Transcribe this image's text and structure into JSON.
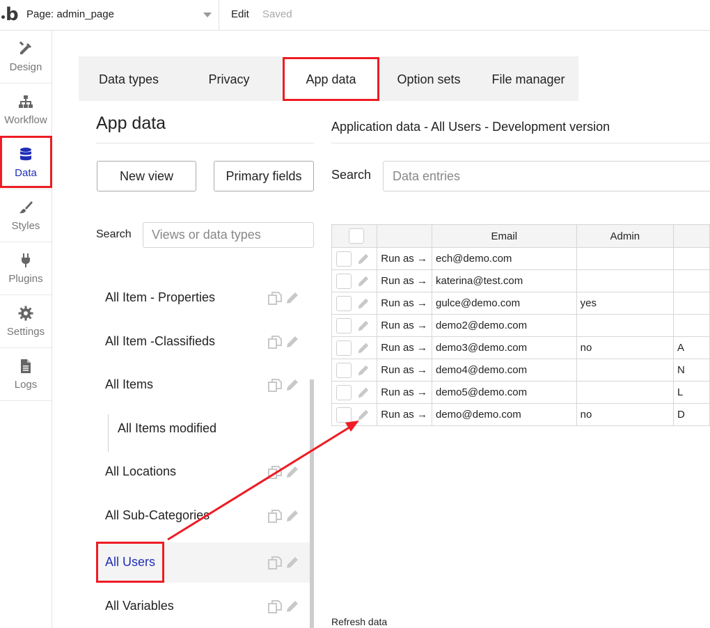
{
  "topbar": {
    "page_label": "Page: admin_page",
    "edit_label": "Edit",
    "saved_label": "Saved"
  },
  "nav": {
    "items": [
      {
        "label": "Design",
        "icon": "design-icon"
      },
      {
        "label": "Workflow",
        "icon": "workflow-icon"
      },
      {
        "label": "Data",
        "icon": "database-icon",
        "active": true
      },
      {
        "label": "Styles",
        "icon": "brush-icon"
      },
      {
        "label": "Plugins",
        "icon": "plug-icon"
      },
      {
        "label": "Settings",
        "icon": "gear-icon"
      },
      {
        "label": "Logs",
        "icon": "document-icon"
      }
    ]
  },
  "tabs": [
    {
      "label": "Data types"
    },
    {
      "label": "Privacy"
    },
    {
      "label": "App data",
      "active": true
    },
    {
      "label": "Option sets"
    },
    {
      "label": "File manager"
    }
  ],
  "panel": {
    "title": "App data",
    "new_view_label": "New view",
    "primary_fields_label": "Primary fields",
    "search_label": "Search",
    "search_placeholder": "Views or data types",
    "views": [
      {
        "label": "All Item - Properties"
      },
      {
        "label": "All Item -Classifieds"
      },
      {
        "label": "All Items"
      },
      {
        "label": "All Items modified",
        "child": true
      },
      {
        "label": "All Locations"
      },
      {
        "label": "All Sub-Categories"
      },
      {
        "label": "All Users",
        "selected": true
      },
      {
        "label": "All Variables"
      }
    ]
  },
  "content": {
    "title": "Application data - All Users - Development version",
    "search_label": "Search",
    "search_placeholder": "Data entries",
    "refresh_label": "Refresh data",
    "table": {
      "headers": [
        "Email",
        "Admin"
      ],
      "run_as_label": "Run as →",
      "rows": [
        {
          "email": "ech@demo.com",
          "admin": "",
          "extra": ""
        },
        {
          "email": "katerina@test.com",
          "admin": "",
          "extra": ""
        },
        {
          "email": "gulce@demo.com",
          "admin": "yes",
          "extra": ""
        },
        {
          "email": "demo2@demo.com",
          "admin": "",
          "extra": ""
        },
        {
          "email": "demo3@demo.com",
          "admin": "no",
          "extra": "A"
        },
        {
          "email": "demo4@demo.com",
          "admin": "",
          "extra": "N"
        },
        {
          "email": "demo5@demo.com",
          "admin": "",
          "extra": "L"
        },
        {
          "email": "demo@demo.com",
          "admin": "no",
          "extra": "D"
        }
      ]
    }
  },
  "colors": {
    "highlight": "#ee1c24",
    "accent": "#1f2eb5"
  }
}
